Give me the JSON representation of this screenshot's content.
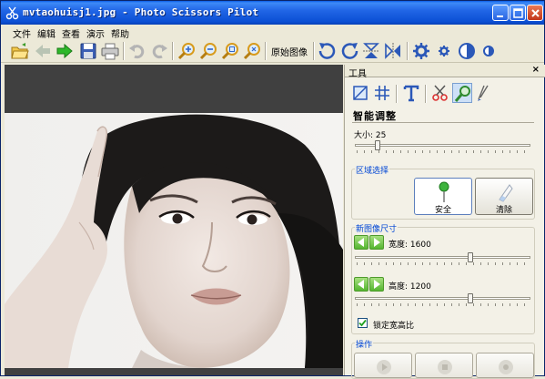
{
  "window": {
    "title": "mvtaohuisj1.jpg - Photo Scissors Pilot"
  },
  "menu": [
    "文件",
    "编辑",
    "查看",
    "演示",
    "帮助"
  ],
  "toolbar": {
    "original_image_label": "原始图像",
    "icons": [
      "open-icon",
      "back-arrow-icon",
      "forward-arrow-icon",
      "save-icon",
      "print-icon",
      "undo-icon",
      "redo-icon",
      "zoom-in-icon",
      "zoom-out-icon",
      "zoom-fit-icon",
      "zoom-actual-icon",
      "rotate-left-icon",
      "rotate-right-icon",
      "flip-vertical-icon",
      "flip-horizontal-icon",
      "settings-icon",
      "gear-small-icon",
      "contrast-icon",
      "contrast-small-icon"
    ]
  },
  "panel": {
    "header": "工具",
    "tools": [
      "crop-icon",
      "grid-icon",
      "text-icon",
      "scissors-icon",
      "magnifier-icon",
      "brush-icon"
    ],
    "title": "智能调整",
    "size_label": "大小: 25",
    "size_value": 25,
    "region": {
      "label": "区域选择",
      "safe_label": "安全",
      "clear_label": "清除"
    },
    "new_size": {
      "label": "新图像尺寸",
      "width_label": "宽度: 1600",
      "height_label": "高度: 1200",
      "width_value": 1600,
      "height_value": 1200
    },
    "lock_ratio_label": "锁定宽高比",
    "lock_ratio_checked": true,
    "operations_label": "操作"
  },
  "colors": {
    "titlebar": "#2166e6",
    "accent_blue": "#0046d5",
    "canvas_bg": "#404040",
    "panel_bg": "#f3f1e7"
  }
}
